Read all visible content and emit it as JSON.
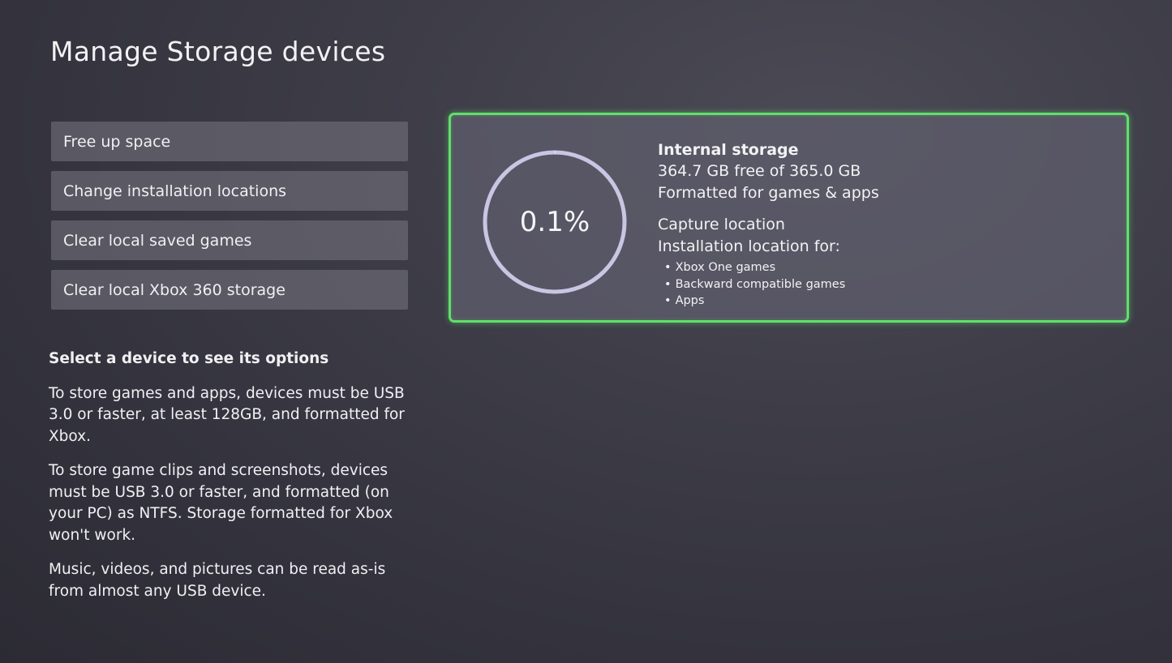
{
  "page": {
    "title": "Manage Storage devices"
  },
  "menu": {
    "items": [
      {
        "label": "Free up space"
      },
      {
        "label": "Change installation locations"
      },
      {
        "label": "Clear local saved games"
      },
      {
        "label": "Clear local Xbox 360 storage"
      }
    ]
  },
  "info": {
    "heading": "Select a device to see its options",
    "paragraphs": [
      "To store games and apps, devices must be USB 3.0 or faster, at least 128GB, and formatted for Xbox.",
      "To store game clips and screenshots, devices must be USB 3.0 or faster, and formatted (on your PC) as NTFS. Storage formatted for Xbox won't work.",
      "Music, videos, and pictures can be read as-is from almost any USB device."
    ]
  },
  "device": {
    "name": "Internal storage",
    "usage_percent_label": "0.1%",
    "usage_fraction": 0.001,
    "free_text": "364.7 GB free of 365.0 GB",
    "format_text": "Formatted for games & apps",
    "capture_text": "Capture location",
    "install_heading": "Installation location for:",
    "install_locations": [
      "Xbox One games",
      "Backward compatible games",
      "Apps"
    ]
  },
  "colors": {
    "accent_border": "#5fe06a",
    "ring": "#c9c5e3"
  }
}
